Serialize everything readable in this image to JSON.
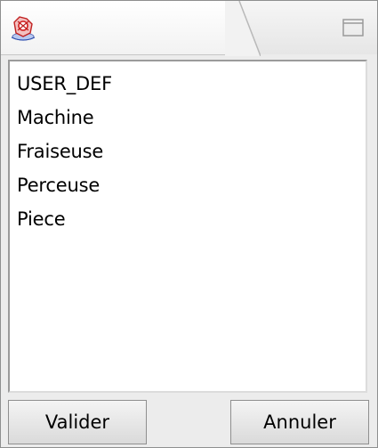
{
  "window": {
    "app_icon": "application-icon",
    "maximize_icon": "maximize-icon"
  },
  "list": {
    "items": [
      "USER_DEF",
      "Machine",
      "Fraiseuse",
      "Perceuse",
      "Piece"
    ]
  },
  "buttons": {
    "ok_label": "Valider",
    "cancel_label": "Annuler"
  }
}
